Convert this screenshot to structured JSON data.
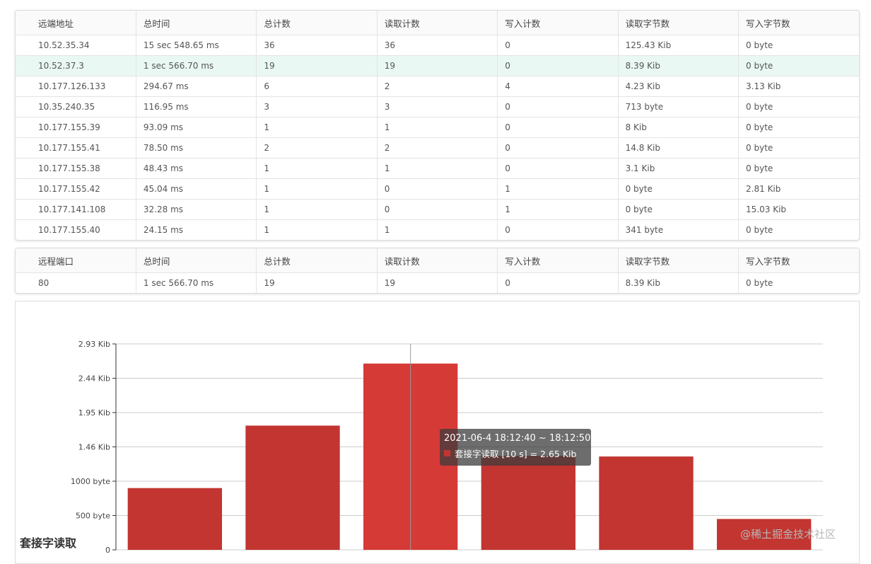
{
  "table_hosts": {
    "headers": [
      "远端地址",
      "总时间",
      "总计数",
      "读取计数",
      "写入计数",
      "读取字节数",
      "写入字节数"
    ],
    "rows": [
      [
        "10.52.35.34",
        "15 sec 548.65 ms",
        "36",
        "36",
        "0",
        "125.43 Kib",
        "0 byte"
      ],
      [
        "10.52.37.3",
        "1 sec 566.70 ms",
        "19",
        "19",
        "0",
        "8.39 Kib",
        "0 byte"
      ],
      [
        "10.177.126.133",
        "294.67 ms",
        "6",
        "2",
        "4",
        "4.23 Kib",
        "3.13 Kib"
      ],
      [
        "10.35.240.35",
        "116.95 ms",
        "3",
        "3",
        "0",
        "713 byte",
        "0 byte"
      ],
      [
        "10.177.155.39",
        "93.09 ms",
        "1",
        "1",
        "0",
        "8 Kib",
        "0 byte"
      ],
      [
        "10.177.155.41",
        "78.50 ms",
        "2",
        "2",
        "0",
        "14.8 Kib",
        "0 byte"
      ],
      [
        "10.177.155.38",
        "48.43 ms",
        "1",
        "1",
        "0",
        "3.1 Kib",
        "0 byte"
      ],
      [
        "10.177.155.42",
        "45.04 ms",
        "1",
        "0",
        "1",
        "0 byte",
        "2.81 Kib"
      ],
      [
        "10.177.141.108",
        "32.28 ms",
        "1",
        "0",
        "1",
        "0 byte",
        "15.03 Kib"
      ],
      [
        "10.177.155.40",
        "24.15 ms",
        "1",
        "1",
        "0",
        "341 byte",
        "0 byte"
      ]
    ],
    "highlight_row": 1
  },
  "table_ports": {
    "headers": [
      "远程端口",
      "总时间",
      "总计数",
      "读取计数",
      "写入计数",
      "读取字节数",
      "写入字节数"
    ],
    "rows": [
      [
        "80",
        "1 sec 566.70 ms",
        "19",
        "19",
        "0",
        "8.39 Kib",
        "0 byte"
      ]
    ]
  },
  "chart": {
    "title": "套接字读取",
    "tooltip": {
      "time_range": "2021-06-4 18:12:40 ~ 18:12:50",
      "series_text": "套接字读取 [10 s] = 2.65 Kib"
    },
    "watermark": "@稀土掘金技术社区"
  },
  "chart_data": {
    "type": "bar",
    "title": "套接字读取",
    "ylim_bytes": [
      0,
      3000
    ],
    "y_ticks": [
      {
        "value": 0,
        "label": "0"
      },
      {
        "value": 500,
        "label": "500 byte"
      },
      {
        "value": 1000,
        "label": "1000 byte"
      },
      {
        "value": 1500,
        "label": "1.46 Kib"
      },
      {
        "value": 2000,
        "label": "1.95 Kib"
      },
      {
        "value": 2500,
        "label": "2.44 Kib"
      },
      {
        "value": 3000,
        "label": "2.93 Kib"
      }
    ],
    "values_bytes": [
      900,
      1810,
      2714,
      1370,
      1360,
      450
    ],
    "highlight_index": 2,
    "colors": {
      "bar": "#c23531",
      "bar_highlight": "#d63a36",
      "grid": "#cccccc"
    }
  }
}
